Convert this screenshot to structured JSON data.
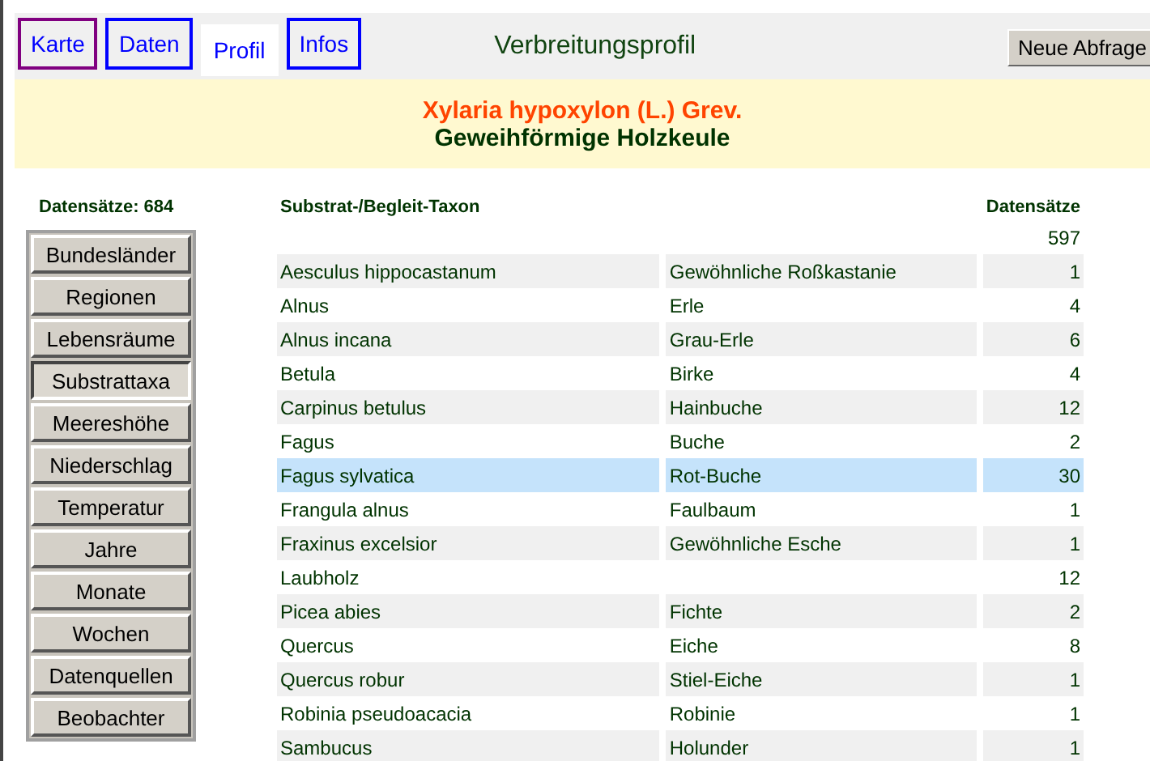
{
  "tabs": [
    {
      "label": "Karte",
      "selected": false,
      "visited": true
    },
    {
      "label": "Daten",
      "selected": false,
      "visited": false
    },
    {
      "label": "Profil",
      "selected": true,
      "visited": false
    },
    {
      "label": "Infos",
      "selected": false,
      "visited": false
    }
  ],
  "page_title": "Verbreitungsprofil",
  "new_query_button": "Neue Abfrage",
  "species": {
    "scientific_name": "Xylaria hypoxylon (L.) Grev.",
    "common_name": "Geweihförmige Holzkeule"
  },
  "record_count": "Datensätze: 684",
  "categories": [
    {
      "label": "Bundesländer",
      "selected": false
    },
    {
      "label": "Regionen",
      "selected": false
    },
    {
      "label": "Lebensräume",
      "selected": false
    },
    {
      "label": "Substrattaxa",
      "selected": true
    },
    {
      "label": "Meereshöhe",
      "selected": false
    },
    {
      "label": "Niederschlag",
      "selected": false
    },
    {
      "label": "Temperatur",
      "selected": false
    },
    {
      "label": "Jahre",
      "selected": false
    },
    {
      "label": "Monate",
      "selected": false
    },
    {
      "label": "Wochen",
      "selected": false
    },
    {
      "label": "Datenquellen",
      "selected": false
    },
    {
      "label": "Beobachter",
      "selected": false
    }
  ],
  "table": {
    "columns": [
      "Substrat-/Begleit-Taxon",
      "Datensätze"
    ],
    "rows": [
      {
        "count": "597",
        "selected": false
      },
      {
        "taxon": "Aesculus hippocastanum",
        "german_name": "Gewöhnliche Roßkastanie",
        "count": "1",
        "selected": false
      },
      {
        "taxon": "Alnus",
        "german_name": "Erle",
        "count": "4",
        "selected": false
      },
      {
        "taxon": "Alnus incana",
        "german_name": "Grau-Erle",
        "count": "6",
        "selected": false
      },
      {
        "taxon": "Betula",
        "german_name": "Birke",
        "count": "4",
        "selected": false
      },
      {
        "taxon": "Carpinus betulus",
        "german_name": "Hainbuche",
        "count": "12",
        "selected": false
      },
      {
        "taxon": "Fagus",
        "german_name": "Buche",
        "count": "2",
        "selected": false
      },
      {
        "taxon": "Fagus sylvatica",
        "german_name": "Rot-Buche",
        "count": "30",
        "selected": true
      },
      {
        "taxon": "Frangula alnus",
        "german_name": "Faulbaum",
        "count": "1",
        "selected": false
      },
      {
        "taxon": "Fraxinus excelsior",
        "german_name": "Gewöhnliche Esche",
        "count": "1",
        "selected": false
      },
      {
        "taxon": "Laubholz",
        "count": "12",
        "selected": false
      },
      {
        "taxon": "Picea abies",
        "german_name": "Fichte",
        "count": "2",
        "selected": false
      },
      {
        "taxon": "Quercus",
        "german_name": "Eiche",
        "count": "8",
        "selected": false
      },
      {
        "taxon": "Quercus robur",
        "german_name": "Stiel-Eiche",
        "count": "1",
        "selected": false
      },
      {
        "taxon": "Robinia pseudoacacia",
        "german_name": "Robinie",
        "count": "1",
        "selected": false
      },
      {
        "taxon": "Sambucus",
        "german_name": "Holunder",
        "count": "1",
        "selected": false
      }
    ]
  }
}
